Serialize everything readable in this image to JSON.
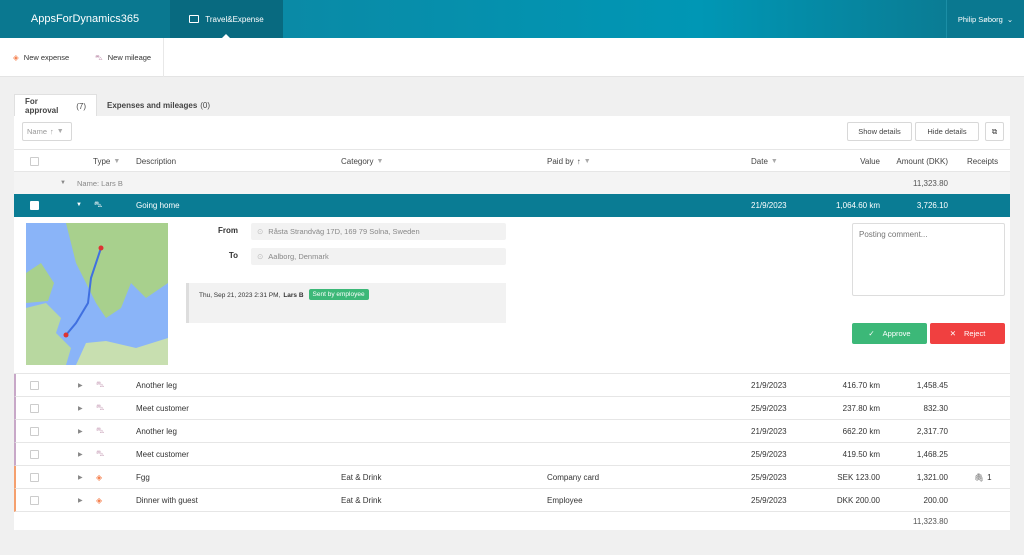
{
  "header": {
    "brand": "AppsForDynamics365",
    "app_tab": "Travel&Expense",
    "user": "Philip Søborg"
  },
  "toolbar": {
    "new_expense": "New expense",
    "new_mileage": "New mileage"
  },
  "tabs": [
    {
      "label": "For approval",
      "count": "(7)"
    },
    {
      "label": "Expenses and mileages",
      "count": "(0)"
    }
  ],
  "grid_toolbar": {
    "sort_field": "Name",
    "show_details": "Show details",
    "hide_details": "Hide details"
  },
  "columns": {
    "type": "Type",
    "description": "Description",
    "category": "Category",
    "paid_by": "Paid by",
    "date": "Date",
    "value": "Value",
    "amount": "Amount (DKK)",
    "receipts": "Receipts"
  },
  "group": {
    "label": "Name: Lars B",
    "total": "11,323.80"
  },
  "selected": {
    "description": "Going home",
    "date": "21/9/2023",
    "value": "1,064.60 km",
    "amount": "3,726.10"
  },
  "details": {
    "from_label": "From",
    "from": "Råsta Strandväg 17D, 169 79 Solna, Sweden",
    "to_label": "To",
    "to": "Aalborg, Denmark",
    "history_time": "Thu, Sep 21, 2023 2:31 PM,",
    "history_user": "Lars B",
    "history_badge": "Sent by employee",
    "comment_placeholder": "Posting comment...",
    "approve": "Approve",
    "reject": "Reject"
  },
  "rows": [
    {
      "type": "mileage",
      "description": "Another leg",
      "category": "",
      "paid_by": "",
      "date": "21/9/2023",
      "value": "416.70 km",
      "amount": "1,458.45",
      "receipts": ""
    },
    {
      "type": "mileage",
      "description": "Meet customer",
      "category": "",
      "paid_by": "",
      "date": "25/9/2023",
      "value": "237.80 km",
      "amount": "832.30",
      "receipts": ""
    },
    {
      "type": "mileage",
      "description": "Another leg",
      "category": "",
      "paid_by": "",
      "date": "21/9/2023",
      "value": "662.20 km",
      "amount": "2,317.70",
      "receipts": ""
    },
    {
      "type": "mileage",
      "description": "Meet customer",
      "category": "",
      "paid_by": "",
      "date": "25/9/2023",
      "value": "419.50 km",
      "amount": "1,468.25",
      "receipts": ""
    },
    {
      "type": "expense",
      "description": "Fgg",
      "category": "Eat & Drink",
      "paid_by": "Company card",
      "date": "25/9/2023",
      "value": "SEK 123.00",
      "amount": "1,321.00",
      "receipts": "1"
    },
    {
      "type": "expense",
      "description": "Dinner with guest",
      "category": "Eat & Drink",
      "paid_by": "Employee",
      "date": "25/9/2023",
      "value": "DKK 200.00",
      "amount": "200.00",
      "receipts": ""
    }
  ],
  "footer": {
    "total": "11,323.80"
  },
  "colors": {
    "header": "#0a7890",
    "selected_row": "#0a7c94",
    "approve": "#3cb878",
    "reject": "#f04040",
    "badge": "#3cb878",
    "mileage_marker": "#c8a8c8",
    "expense_marker": "#f5a06e"
  }
}
